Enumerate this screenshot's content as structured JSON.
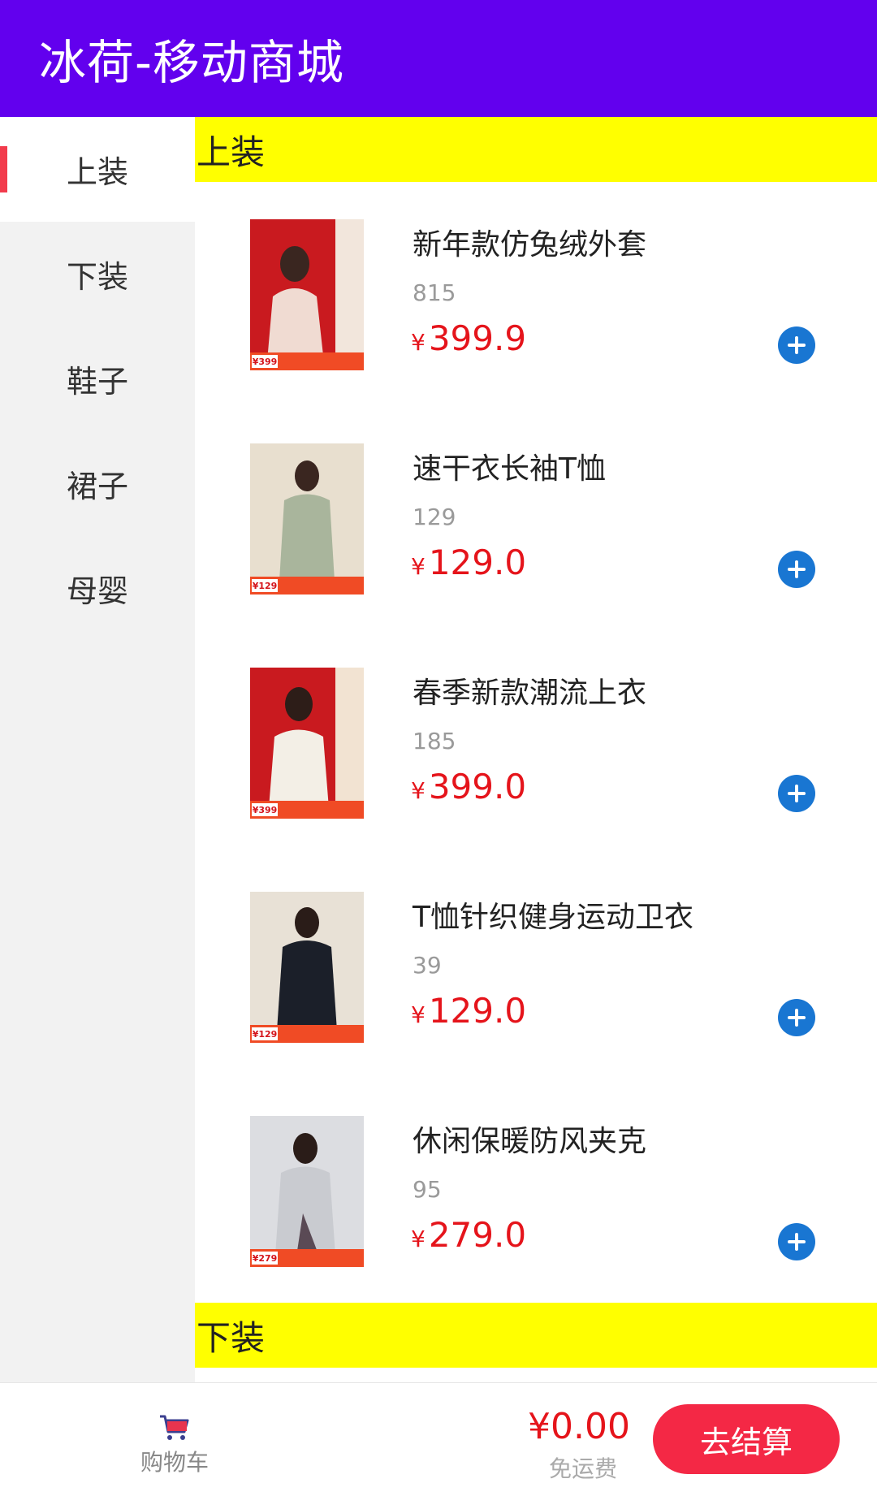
{
  "app": {
    "title": "冰荷-移动商城"
  },
  "sidebar": {
    "items": [
      {
        "label": "上装",
        "active": true
      },
      {
        "label": "下装",
        "active": false
      },
      {
        "label": "鞋子",
        "active": false
      },
      {
        "label": "裙子",
        "active": false
      },
      {
        "label": "母婴",
        "active": false
      }
    ]
  },
  "sections": [
    {
      "title": "上装",
      "products": [
        {
          "name": "新年款仿兔绒外套",
          "sales": "815",
          "currency": "¥",
          "price": "399.9",
          "thumb_price": "¥399",
          "thumb_colors": [
            "#c91a1f",
            "#f2e6dc"
          ]
        },
        {
          "name": "速干衣长袖T恤",
          "sales": "129",
          "currency": "¥",
          "price": "129.0",
          "thumb_price": "¥129",
          "thumb_colors": [
            "#e8dfcf",
            "#a9b59c"
          ]
        },
        {
          "name": "春季新款潮流上衣",
          "sales": "185",
          "currency": "¥",
          "price": "399.0",
          "thumb_price": "¥399",
          "thumb_colors": [
            "#c91a1f",
            "#f3efe6"
          ]
        },
        {
          "name": "T恤针织健身运动卫衣",
          "sales": "39",
          "currency": "¥",
          "price": "129.0",
          "thumb_price": "¥129",
          "thumb_colors": [
            "#e8e1d6",
            "#1b1f29"
          ]
        },
        {
          "name": "休闲保暖防风夹克",
          "sales": "95",
          "currency": "¥",
          "price": "279.0",
          "thumb_price": "¥279",
          "thumb_colors": [
            "#dcdde1",
            "#5a4a55"
          ]
        }
      ]
    },
    {
      "title": "下装"
    }
  ],
  "bottom_bar": {
    "cart_label": "购物车",
    "total": "¥0.00",
    "shipping": "免运费",
    "checkout_label": "去结算"
  },
  "colors": {
    "app_bar": "#6200ee",
    "section_header": "#ffff00",
    "price": "#e5141b",
    "add_button": "#1976d2",
    "checkout": "#f42845",
    "active_marker": "#f23b4c"
  }
}
